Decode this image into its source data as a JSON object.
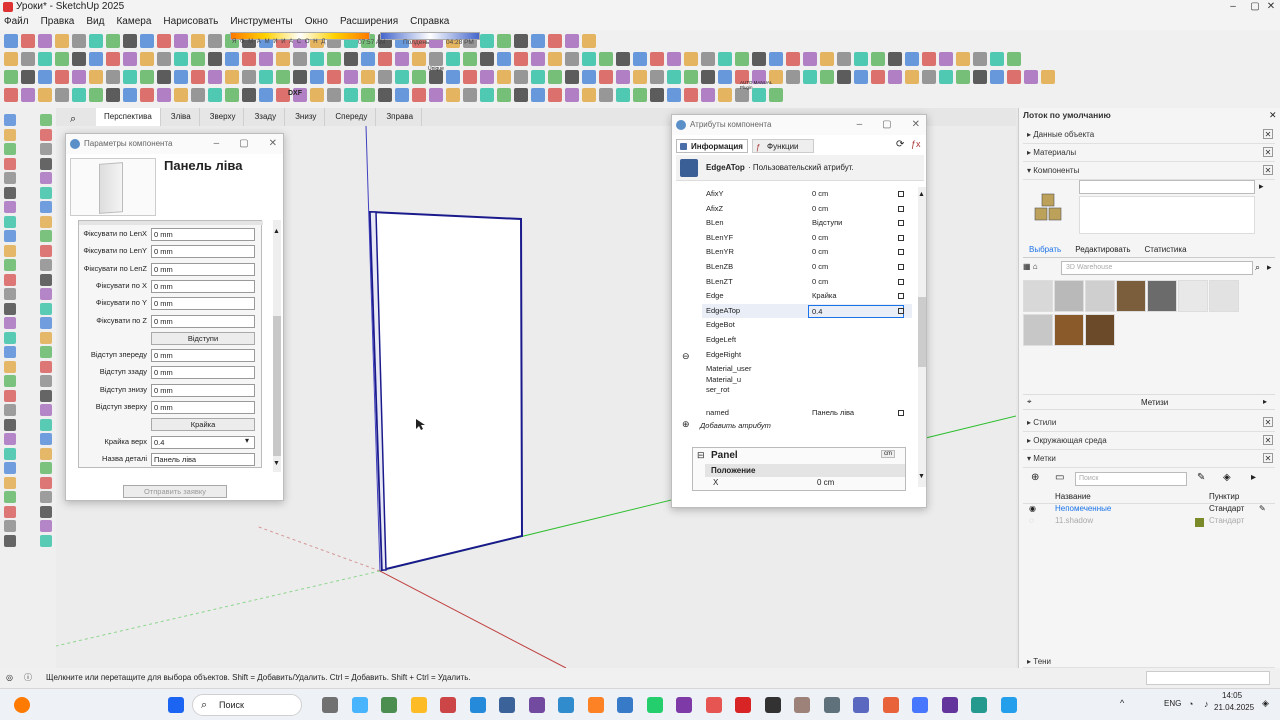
{
  "app": {
    "title": "Уроки* - SketchUp 2025"
  },
  "menu": [
    "Файл",
    "Правка",
    "Вид",
    "Камера",
    "Нарисовать",
    "Инструменты",
    "Окно",
    "Расширения",
    "Справка"
  ],
  "shadow_toolbar": {
    "months": "Я Ф М А М И И А С О Н Д",
    "time_start": "07:57 AM",
    "noon": "Полдень",
    "time_end": "04:28 PM"
  },
  "toolbar_labels": {
    "dxf": "DXF",
    "unique": "Unique",
    "automanual": "AUTO MANUAL Plugin"
  },
  "scene_tabs": [
    "Перспектива",
    "Зліва",
    "Зверху",
    "Ззаду",
    "Знизу",
    "Спереду",
    "Зправа"
  ],
  "component_params": {
    "title": "Параметры компонента",
    "name": "Панель ліва",
    "rows": [
      {
        "label": "Фіксувати по LenX",
        "value": "0 mm"
      },
      {
        "label": "Фіксувати по LenY",
        "value": "0 mm"
      },
      {
        "label": "Фіксувати по LenZ",
        "value": "0 mm"
      },
      {
        "label": "Фіксувати по X",
        "value": "0 mm"
      },
      {
        "label": "Фіксувати по Y",
        "value": "0 mm"
      },
      {
        "label": "Фіксувати по Z",
        "value": "0 mm"
      }
    ],
    "section_otstupy": "Відступи",
    "otstupy_rows": [
      {
        "label": "Відступ зпереду",
        "value": "0 mm"
      },
      {
        "label": "Відступ ззаду",
        "value": "0 mm"
      },
      {
        "label": "Відступ знизу",
        "value": "0 mm"
      },
      {
        "label": "Відступ зверху",
        "value": "0 mm"
      }
    ],
    "section_kraika": "Крайка",
    "kraika_label": "Крайка верх",
    "kraika_value": "0.4",
    "detail_label": "Назва деталі",
    "detail_value": "Панель ліва",
    "submit": "Отправить заявку"
  },
  "component_attrs": {
    "title": "Атрибуты компонента",
    "tab_info": "Информация",
    "tab_func": "Функции",
    "attr_name": "EdgeATop",
    "attr_desc": "· Пользовательский атрибут.",
    "rows": [
      {
        "key": "AfixY",
        "value": "0 cm",
        "icon": true
      },
      {
        "key": "AfixZ",
        "value": "0 cm",
        "icon": true
      },
      {
        "key": "BLen",
        "value": "Відступи",
        "icon": true
      },
      {
        "key": "BLenYF",
        "value": "0 cm",
        "icon": true
      },
      {
        "key": "BLenYR",
        "value": "0 cm",
        "icon": true
      },
      {
        "key": "BLenZB",
        "value": "0 cm",
        "icon": true
      },
      {
        "key": "BLenZT",
        "value": "0 cm",
        "icon": true
      },
      {
        "key": "Edge",
        "value": "Крайка",
        "icon": true
      },
      {
        "key": "EdgeATop",
        "value": "0.4",
        "icon": true
      },
      {
        "key": "EdgeBot",
        "value": "",
        "icon": false
      },
      {
        "key": "EdgeLeft",
        "value": "",
        "icon": false
      },
      {
        "key": "EdgeRight",
        "value": "",
        "icon": false
      },
      {
        "key": "Material_user",
        "value": "",
        "icon": false
      },
      {
        "key": "Material_u ser_rot",
        "value": "",
        "icon": false
      },
      {
        "key": "named",
        "value": "Панель ліва",
        "icon": true
      }
    ],
    "add_attr": "Добавить атрибут",
    "panel_section": "Panel",
    "panel_unit": "cm",
    "position": "Положение",
    "x_label": "X",
    "x_value": "0 cm"
  },
  "tray": {
    "title": "Лоток по умолчанию",
    "sections": [
      "Данные объекта",
      "Материалы",
      "Компоненты"
    ],
    "tabs": [
      "Выбрать",
      "Редактировать",
      "Статистика"
    ],
    "search_placeholder": "3D Warehouse",
    "metizy": "Метизи",
    "styles": "Стили",
    "env": "Окружающая среда",
    "tags": "Метки",
    "tag_search": "Поиск",
    "col_name": "Название",
    "col_dash": "Пунктир",
    "tags_list": [
      {
        "name": "Непомеченные",
        "dash": "Стандарт"
      },
      {
        "name": "11.shadow",
        "dash": "Стандарт"
      }
    ],
    "shadows": "Тени"
  },
  "status": {
    "text": "Щелкните или перетащите для выбора объектов. Shift = Добавить/Удалить. Ctrl = Добавить. Shift + Ctrl = Удалить."
  },
  "taskbar": {
    "search": "Поиск",
    "lang": "ENG",
    "time": "14:05",
    "date": "21.04.2025"
  },
  "colors": {
    "accent": "#1a73e8",
    "panel_edge": "#1a1a8c",
    "axis_green": "#2fbf2f",
    "axis_red": "#c04040",
    "axis_blue": "#4040c0"
  }
}
